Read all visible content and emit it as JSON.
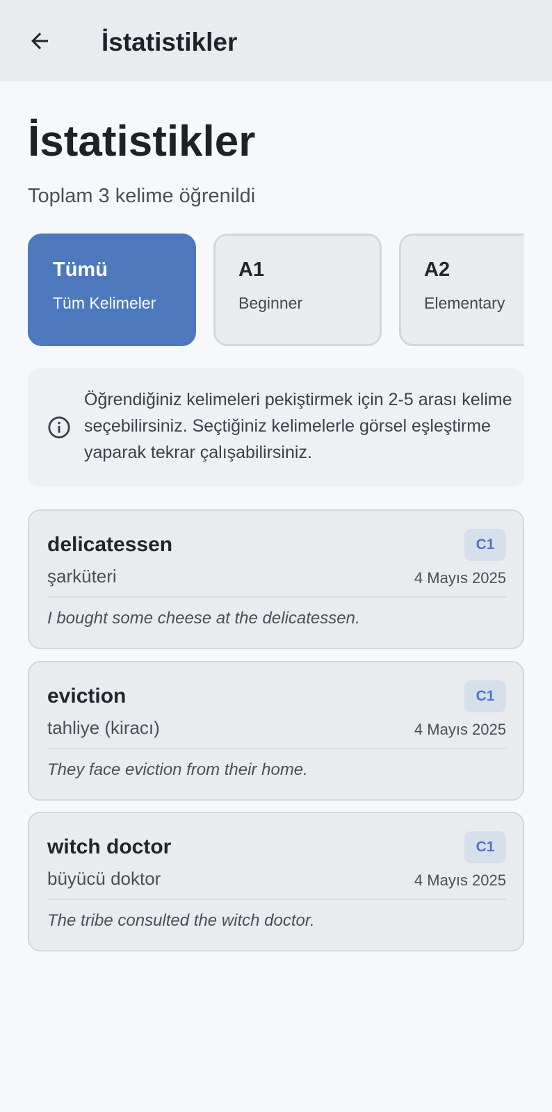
{
  "appbar": {
    "title": "İstatistikler"
  },
  "page": {
    "title": "İstatistikler",
    "subtitle": "Toplam 3 kelime öğrenildi"
  },
  "levels": [
    {
      "name": "Tümü",
      "desc": "Tüm Kelimeler",
      "selected": true
    },
    {
      "name": "A1",
      "desc": "Beginner",
      "selected": false
    },
    {
      "name": "A2",
      "desc": "Elementary",
      "selected": false
    }
  ],
  "info": {
    "icon": "info-icon",
    "text": "Öğrendiğiniz kelimeleri pekiştirmek için 2-5 arası kelime seçebilirsiniz. Seçtiğiniz kelimelerle görsel eşleştirme yaparak tekrar çalışabilirsiniz."
  },
  "words": [
    {
      "word": "delicatessen",
      "meaning": "şarküteri",
      "level": "C1",
      "date": "4 Mayıs 2025",
      "example": "I bought some cheese at the delicatessen."
    },
    {
      "word": "eviction",
      "meaning": "tahliye (kiracı)",
      "level": "C1",
      "date": "4 Mayıs 2025",
      "example": "They face eviction from their home."
    },
    {
      "word": "witch doctor",
      "meaning": "büyücü doktor",
      "level": "C1",
      "date": "4 Mayıs 2025",
      "example": "The tribe consulted the witch doctor."
    }
  ],
  "colors": {
    "accent": "#4d78bd",
    "badge_bg": "#d6dfec",
    "appbar_bg": "#e9ebee"
  }
}
